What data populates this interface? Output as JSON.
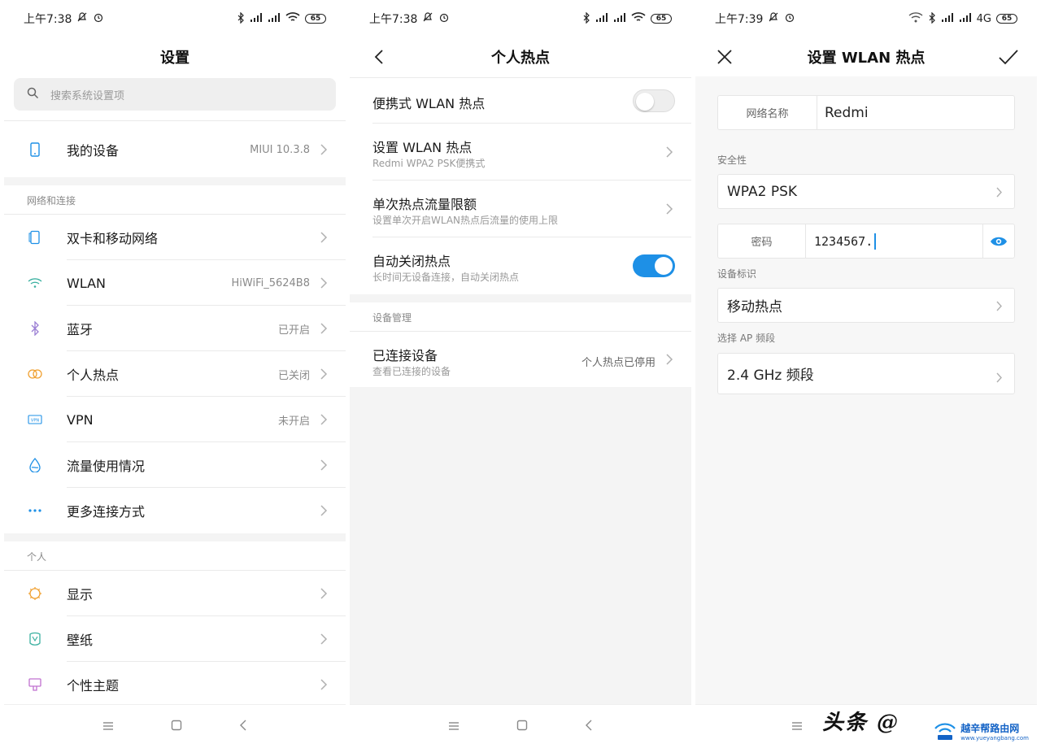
{
  "colors": {
    "accent": "#1e90e6",
    "gap": "#f4f4f4",
    "chevron": "#b0b0b0"
  },
  "status_bar": {
    "p1_time": "上午7:38",
    "p2_time": "上午7:38",
    "p3_time": "上午7:39",
    "battery": "65",
    "network_p3": "4G"
  },
  "settings": {
    "title": "设置",
    "search_placeholder": "搜索系统设置项",
    "my_device": {
      "label": "我的设备",
      "value": "MIUI 10.3.8",
      "icon": "phone-icon"
    },
    "section_network": "网络和连接",
    "network_items": [
      {
        "label": "双卡和移动网络",
        "value": "",
        "icon": "sim-icon"
      },
      {
        "label": "WLAN",
        "value": "HiWiFi_5624B8",
        "icon": "wifi-icon"
      },
      {
        "label": "蓝牙",
        "value": "已开启",
        "icon": "bluetooth-icon"
      },
      {
        "label": "个人热点",
        "value": "已关闭",
        "icon": "hotspot-icon"
      },
      {
        "label": "VPN",
        "value": "未开启",
        "icon": "vpn-icon"
      },
      {
        "label": "流量使用情况",
        "value": "",
        "icon": "data-usage-icon"
      },
      {
        "label": "更多连接方式",
        "value": "",
        "icon": "more-icon"
      }
    ],
    "section_personal": "个人",
    "personal_items": [
      {
        "label": "显示",
        "icon": "display-icon"
      },
      {
        "label": "壁纸",
        "icon": "wallpaper-icon"
      },
      {
        "label": "个性主题",
        "icon": "theme-icon"
      }
    ]
  },
  "hotspot": {
    "title": "个人热点",
    "portable": {
      "label": "便携式 WLAN 热点",
      "enabled": false
    },
    "setup": {
      "label": "设置 WLAN 热点",
      "sub": "Redmi WPA2 PSK便携式"
    },
    "limit": {
      "label": "单次热点流量限额",
      "sub": "设置单次开启WLAN热点后流量的使用上限"
    },
    "auto_off": {
      "label": "自动关闭热点",
      "sub": "长时间无设备连接，自动关闭热点",
      "enabled": true
    },
    "section_devices": "设备管理",
    "connected": {
      "label": "已连接设备",
      "sub": "查看已连接的设备",
      "value": "个人热点已停用"
    }
  },
  "setup_wlan": {
    "title": "设置 WLAN 热点",
    "name_key": "网络名称",
    "name_value": "Redmi",
    "security_caption": "安全性",
    "security_value": "WPA2 PSK",
    "password_key": "密码",
    "password_value": "1234567.",
    "device_id_caption": "设备标识",
    "device_id_value": "移动热点",
    "band_caption": "选择 AP 频段",
    "band_value": "2.4 GHz 频段"
  },
  "watermark": {
    "signature": "头条 @",
    "brand": "越辛帮路由网",
    "url": "www.yueyangbang.com"
  }
}
